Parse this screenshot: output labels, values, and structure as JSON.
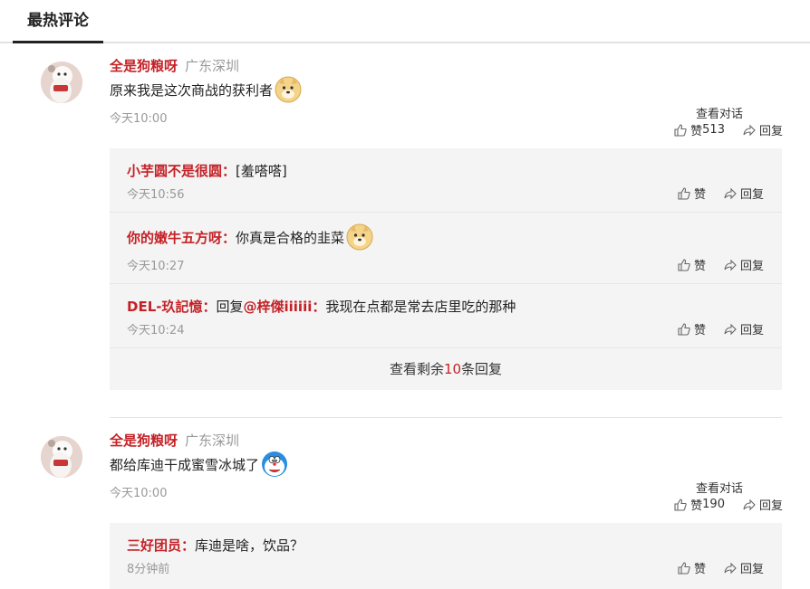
{
  "tab": {
    "label": "最热评论"
  },
  "actions": {
    "like_label": "赞",
    "reply_label": "回复",
    "view_conversation": "查看对话"
  },
  "comments": [
    {
      "user": "全是狗粮呀",
      "location": "广东深圳",
      "text": "原来我是这次商战的获利者",
      "emoji": "doge-emoji",
      "time": "今天10:00",
      "likes": "513",
      "replies": [
        {
          "user": "小芋圆不是很圆：",
          "text": "[羞嗒嗒]",
          "time": "今天10:56"
        },
        {
          "user": "你的嫩牛五方呀：",
          "text": "你真是合格的韭菜",
          "emoji": "doge-emoji",
          "time": "今天10:27"
        },
        {
          "user": "DEL-玖記憶：",
          "prefix": "回复",
          "mention": "@梓傑iiiiii：",
          "text": "我现在点都是常去店里吃的那种",
          "time": "今天10:24"
        }
      ],
      "more": {
        "prefix": "查看剩余",
        "count": "10",
        "suffix": "条回复"
      }
    },
    {
      "user": "全是狗粮呀",
      "location": "广东深圳",
      "text": "都给库迪干成蜜雪冰城了",
      "emoji": "doraemon-emoji",
      "time": "今天10:00",
      "likes": "190",
      "replies": [
        {
          "user": "三好团员：",
          "text": "库迪是啥，饮品？",
          "time": "8分钟前"
        }
      ]
    }
  ],
  "colors": {
    "username": "#c42126",
    "meta": "#999999",
    "reply_bg": "#f4f4f4"
  }
}
